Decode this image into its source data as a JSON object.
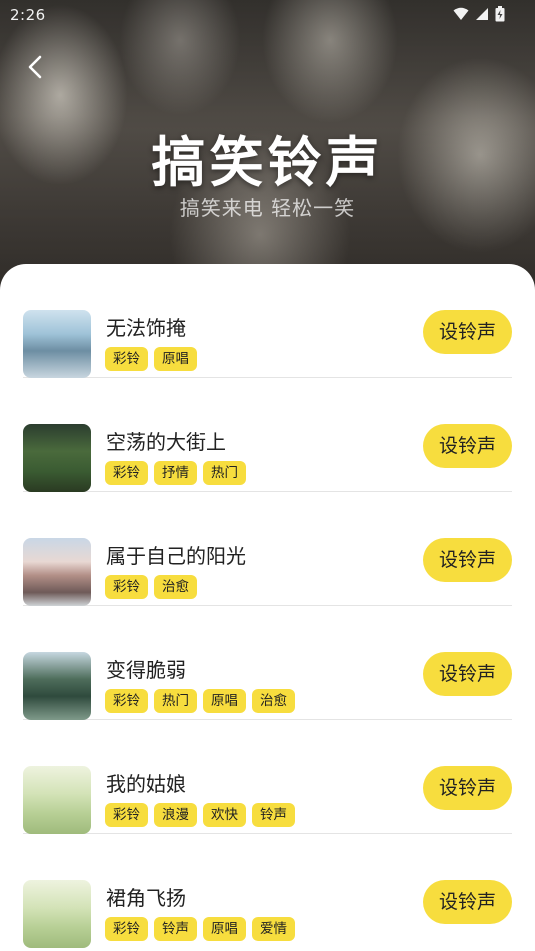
{
  "status_bar": {
    "time": "2:26"
  },
  "header": {
    "title": "搞笑铃声",
    "subtitle": "搞笑来电 轻松一笑"
  },
  "songs": [
    {
      "title": "无法饰掩",
      "tags": [
        "彩铃",
        "原唱"
      ],
      "button": "设铃声"
    },
    {
      "title": "空荡的大街上",
      "tags": [
        "彩铃",
        "抒情",
        "热门"
      ],
      "button": "设铃声"
    },
    {
      "title": "属于自己的阳光",
      "tags": [
        "彩铃",
        "治愈"
      ],
      "button": "设铃声"
    },
    {
      "title": "变得脆弱",
      "tags": [
        "彩铃",
        "热门",
        "原唱",
        "治愈"
      ],
      "button": "设铃声"
    },
    {
      "title": "我的姑娘",
      "tags": [
        "彩铃",
        "浪漫",
        "欢快",
        "铃声"
      ],
      "button": "设铃声"
    },
    {
      "title": "裙角飞扬",
      "tags": [
        "彩铃",
        "铃声",
        "原唱",
        "爱情"
      ],
      "button": "设铃声"
    }
  ],
  "colors": {
    "accent": "#f7dd3e",
    "text": "#222222",
    "divider": "#e4e4e4"
  },
  "icons": {
    "back": "chevron-left-icon",
    "wifi": "wifi-icon",
    "signal": "signal-icon",
    "battery": "battery-icon"
  }
}
